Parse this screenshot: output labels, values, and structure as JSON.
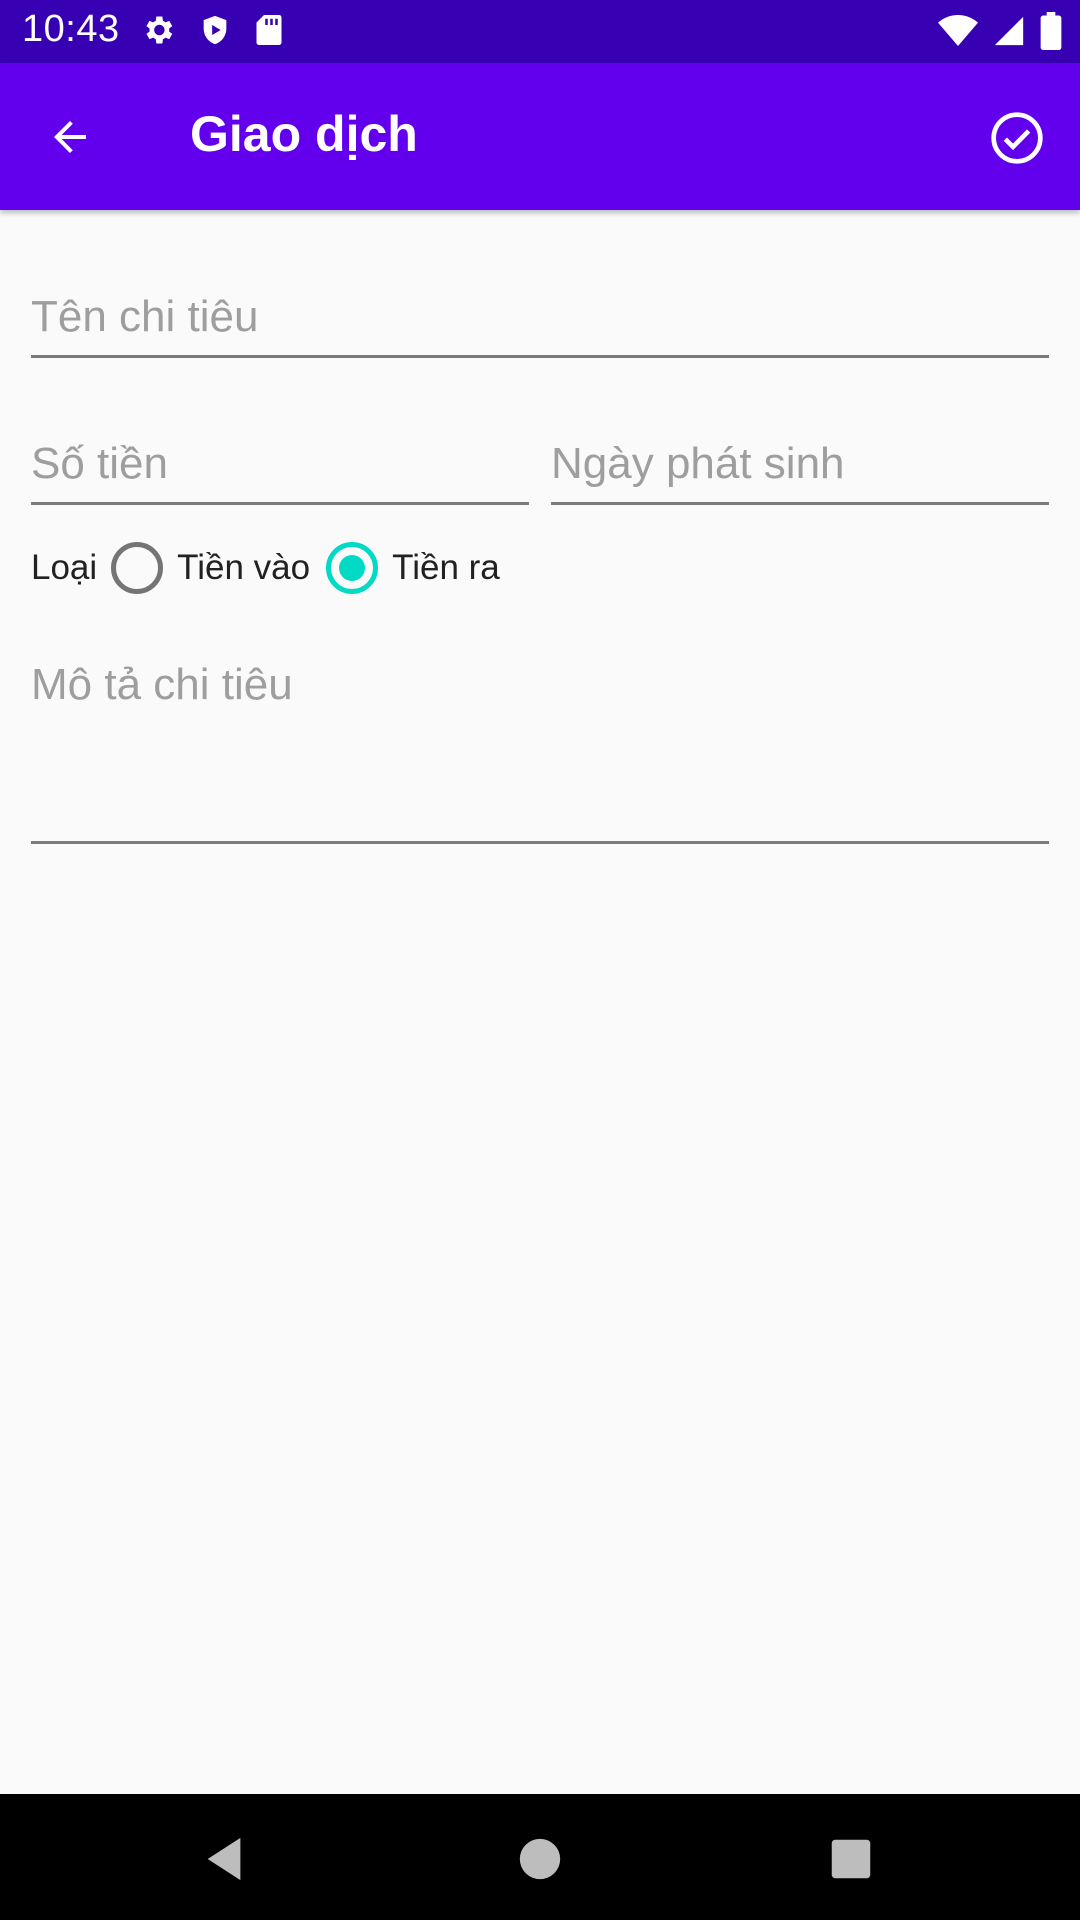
{
  "status_bar": {
    "time": "10:43",
    "icons": [
      "settings-icon",
      "shield-icon",
      "sd-card-icon",
      "wifi-icon",
      "signal-icon",
      "battery-icon"
    ]
  },
  "app_bar": {
    "title": "Giao dịch",
    "back_icon": "arrow-back-icon",
    "confirm_icon": "check-circle-icon"
  },
  "form": {
    "name_placeholder": "Tên chi tiêu",
    "amount_placeholder": "Số tiền",
    "date_placeholder": "Ngày phát sinh",
    "type_label": "Loại",
    "type_options": [
      {
        "label": "Tiền vào",
        "selected": false
      },
      {
        "label": "Tiền ra",
        "selected": true
      }
    ],
    "description_placeholder": "Mô tả chi tiêu"
  },
  "colors": {
    "status_bar": "#3700b3",
    "app_bar": "#6200ee",
    "accent": "#03dac5",
    "background": "#fafafa"
  },
  "nav_bar": {
    "icons": [
      "nav-back-icon",
      "nav-home-icon",
      "nav-recents-icon"
    ]
  }
}
